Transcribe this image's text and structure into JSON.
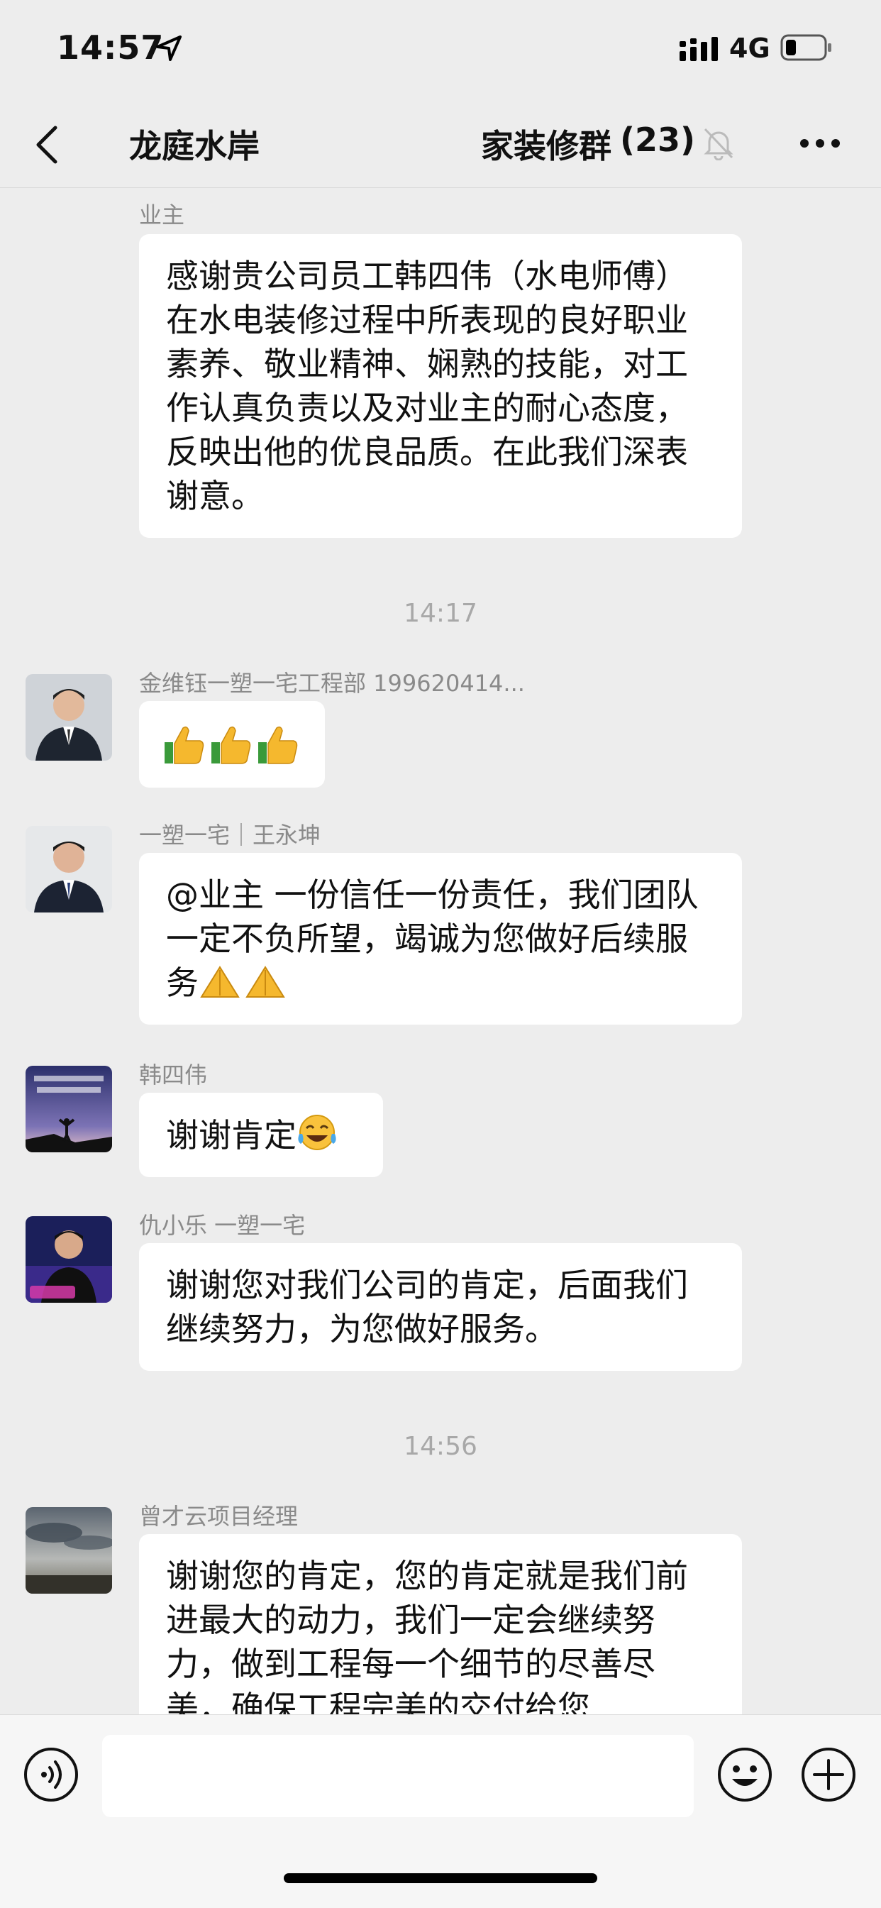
{
  "status_bar": {
    "time": "14:57",
    "network": "4G"
  },
  "nav": {
    "back_label": "",
    "left_title": "龙庭水岸",
    "group_title": "家装修群",
    "member_count": "(23)"
  },
  "messages": [
    {
      "sender": "业主",
      "text": "感谢贵公司员工韩四伟（水电师傅）在水电装修过程中所表现的良好职业素养、敬业精神、娴熟的技能，对工作认真负责以及对业主的耐心态度，反映出他的优良品质。在此我们深表谢意。"
    },
    {
      "sender": "金维钰一塑一宅工程部 199620414...",
      "text": "",
      "emoji": "thumbs-up x3"
    },
    {
      "sender": "一塑一宅｜王永坤",
      "text": "@业主 一份信任一份责任，我们团队一定不负所望，竭诚为您做好后续服务",
      "emoji": "folded-hands x2"
    },
    {
      "sender": "韩四伟",
      "text": "谢谢肯定",
      "emoji": "laughing-tears"
    },
    {
      "sender": "仇小乐 一塑一宅",
      "text": "谢谢您对我们公司的肯定，后面我们继续努力，为您做好服务。"
    },
    {
      "sender": "曾才云项目经理",
      "text": "谢谢您的肯定，您的肯定就是我们前进最大的动力，我们一定会继续努力，做到工程每一个细节的尽善尽美，确保工程完美的交付给您"
    }
  ],
  "timestamps": [
    "14:17",
    "14:56"
  ],
  "icons": {
    "location": "location-arrow-icon",
    "signal": "signal-icon",
    "battery": "battery-icon",
    "back": "chevron-left-icon",
    "mute": "bell-slash-icon",
    "more": "more-dots-icon",
    "voice": "voice-icon",
    "emoji": "smiley-icon",
    "plus": "plus-icon"
  },
  "colors": {
    "background": "#ededed",
    "bubble": "#ffffff",
    "meta_text": "#8a8a8a"
  }
}
